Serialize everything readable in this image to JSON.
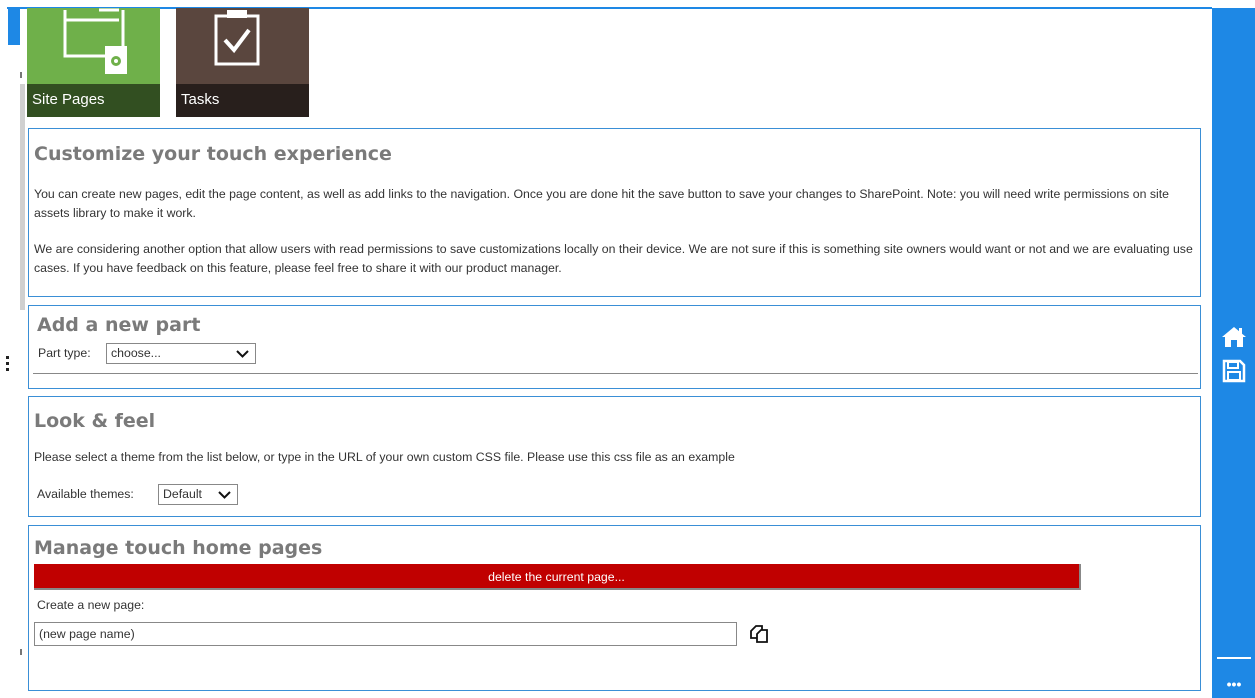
{
  "tiles": [
    {
      "label": "Site Pages",
      "icon": "site-pages-icon",
      "color": "#6fb04a"
    },
    {
      "label": "Tasks",
      "icon": "tasks-checkbox-icon",
      "color": "#5a463e"
    }
  ],
  "intro": {
    "title": "Customize your touch experience",
    "para1": "You can create new pages, edit the page content, as well as add links to the navigation. Once you are done hit the save button to save your changes to SharePoint. Note: you will need write permissions on site assets library to make it work.",
    "para2": "We are considering another option that allow users with read permissions to save customizations locally on their device. We are not sure if this is something site owners would want or not and we are evaluating use cases. If you have feedback on this feature, please feel free to share it with our product manager."
  },
  "add_part": {
    "title": "Add a new part",
    "part_type_label": "Part type:",
    "part_type_value": "choose..."
  },
  "look_feel": {
    "title": "Look & feel",
    "description": "Please select a theme from the list below, or type in the URL of your own custom CSS file. Please use this css file as an example",
    "themes_label": "Available themes:",
    "theme_value": "Default"
  },
  "manage": {
    "title": "Manage touch home pages",
    "delete_label": "delete the current page...",
    "create_label": "Create a new page:",
    "new_page_value": "(new page name)"
  },
  "right_bar": {
    "icons": [
      "home-icon",
      "save-icon",
      "more-icon"
    ],
    "more_label": "•••"
  },
  "colors": {
    "accent": "#1e88e5",
    "panel_border": "#3a8fd6",
    "danger": "#c00000"
  }
}
